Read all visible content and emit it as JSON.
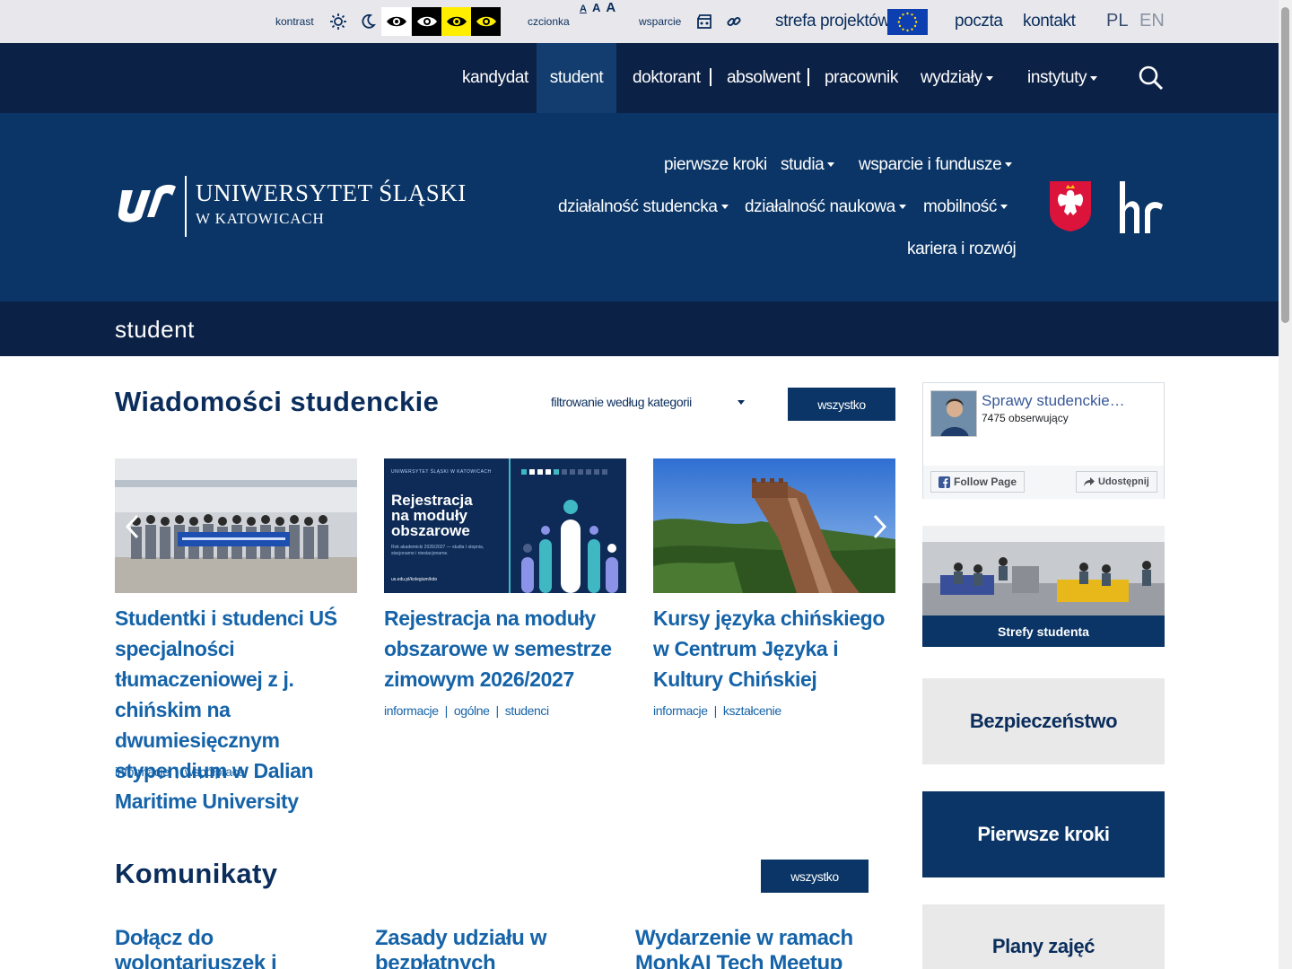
{
  "utility": {
    "contrast_label": "kontrast",
    "font_label": "czcionka",
    "font_sizes": [
      "A",
      "A",
      "A"
    ],
    "support_label": "wsparcie",
    "projects_label": "strefa projektów",
    "mail_label": "poczta",
    "contact_label": "kontakt",
    "lang_pl": "PL",
    "lang_en": "EN"
  },
  "mainnav": {
    "items": [
      "kandydat",
      "student",
      "doktorant",
      "absolwent",
      "pracownik",
      "wydziały",
      "instytuty"
    ],
    "active": "student"
  },
  "logo": {
    "line1": "UNIWERSYTET ŚLĄSKI",
    "line2": "W KATOWICACH"
  },
  "subnav": {
    "items": [
      "pierwsze kroki",
      "studia",
      "wsparcie i fundusze",
      "działalność studencka",
      "działalność naukowa",
      "mobilność",
      "kariera i rozwój"
    ]
  },
  "page_title": "student",
  "news": {
    "title": "Wiadomości studenckie",
    "filter_label": "filtrowanie według kategorii",
    "all_button": "wszystko",
    "items": [
      {
        "title": "Studentki i studenci UŚ specjalności tłumaczeniowej z j. chińskim na dwumiesięcznym stypendium w Dalian Maritime University",
        "tags": [
          "informacje",
          "współpraca"
        ]
      },
      {
        "title": "Rejestracja na moduły obszarowe w semestrze zimowym 2026/2027",
        "tags": [
          "informacje",
          "ogólne",
          "studenci"
        ],
        "image_text": {
          "kicker": "UNIWERSYTET ŚLĄSKI W KATOWICACH",
          "headline_1": "Rejestracja",
          "headline_2": "na moduły",
          "headline_3": "obszarowe",
          "sub_1": "Rok akademicki 2026/2027 — studia I stopnia,",
          "sub_2": "stacjonarne i niestacjonarne.",
          "url": "us.edu.pl/kolegium/kdo"
        }
      },
      {
        "title": "Kursy języka chińskiego w Centrum Języka i Kultury Chińskiej",
        "tags": [
          "informacje",
          "kształcenie"
        ]
      }
    ]
  },
  "announcements": {
    "title": "Komunikaty",
    "all_button": "wszystko",
    "items": [
      "Dołącz do wolontariuszek i",
      "Zasady udziału w bezpłatnych",
      "Wydarzenie w ramach MonkAI Tech Meetup"
    ]
  },
  "sidebar": {
    "facebook": {
      "page_name": "Sprawy studenckie…",
      "followers": "7475 obserwujący",
      "follow_button": "Follow Page",
      "share_button": "Udostępnij"
    },
    "zones_caption": "Strefy studenta",
    "tiles": [
      "Bezpieczeństwo",
      "Pierwsze kroki",
      "Plany zajęć"
    ]
  },
  "colors": {
    "navy": "#0c2146",
    "header_blue": "#0a3566",
    "link_blue": "#1563a8",
    "light_tile": "#e9e9e9"
  }
}
